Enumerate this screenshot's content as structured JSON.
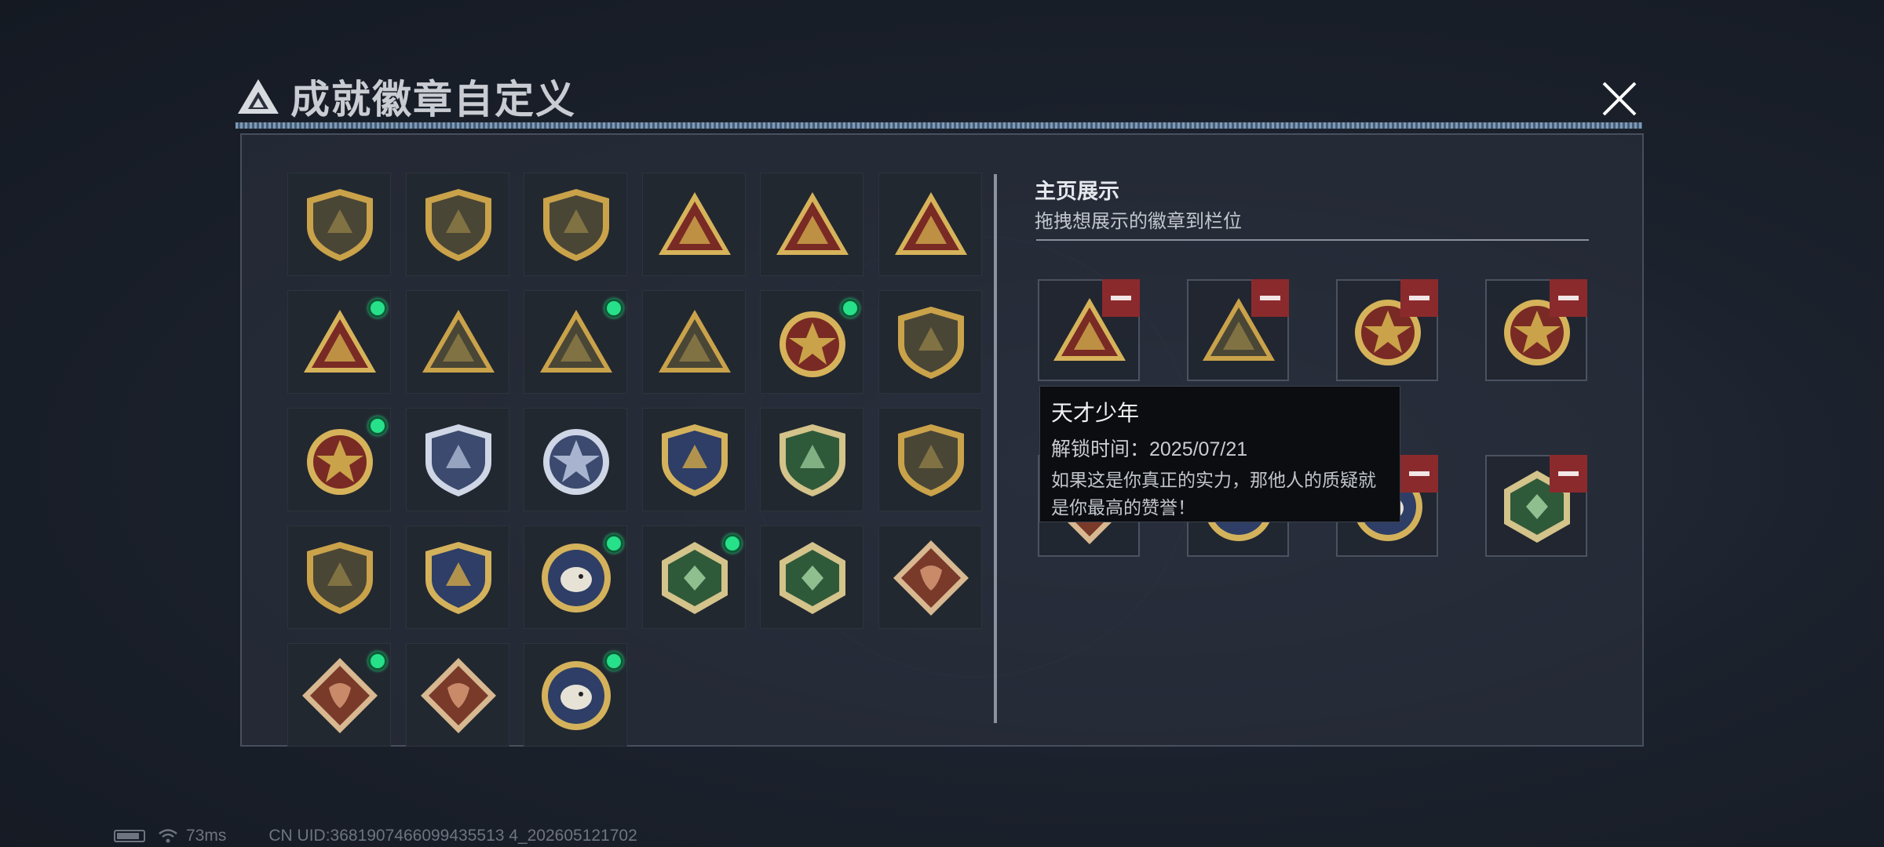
{
  "window": {
    "title": "成就徽章自定义"
  },
  "colors": {
    "accent_new": "#27e08a",
    "remove": "#8b2a2d",
    "gold": "#c9a24a"
  },
  "badge_grid": {
    "rows": [
      [
        {
          "icon": "shield-triangle-badge",
          "shape": "shield",
          "tone": "olive",
          "new": false
        },
        {
          "icon": "helicopter-badge",
          "shape": "shield",
          "tone": "olive",
          "new": false
        },
        {
          "icon": "dagger-shield-badge",
          "shape": "shield",
          "tone": "olive",
          "new": false
        },
        {
          "icon": "ammo-box-triangle-badge",
          "shape": "triangle",
          "tone": "red",
          "new": false
        },
        {
          "icon": "bird-triangle-badge",
          "shape": "triangle",
          "tone": "red",
          "new": false
        },
        {
          "icon": "number-one-triangle-badge",
          "shape": "triangle",
          "tone": "red",
          "new": false
        }
      ],
      [
        {
          "icon": "usb-triangle-badge",
          "shape": "triangle",
          "tone": "red",
          "new": true
        },
        {
          "icon": "runner-triangle-badge",
          "shape": "triangle",
          "tone": "olive",
          "new": false
        },
        {
          "icon": "cube-hands-triangle-badge",
          "shape": "triangle",
          "tone": "olive",
          "new": true
        },
        {
          "icon": "soldiers-triangle-badge",
          "shape": "triangle",
          "tone": "olive",
          "new": false
        },
        {
          "icon": "star-medal-badge",
          "shape": "medal",
          "tone": "red",
          "new": true
        },
        {
          "icon": "emblem-shield-badge",
          "shape": "shield",
          "tone": "olive",
          "new": false
        }
      ],
      [
        {
          "icon": "winged-gold-medal-badge",
          "shape": "medal",
          "tone": "red",
          "new": true
        },
        {
          "icon": "diamond-shield-badge",
          "shape": "shield",
          "tone": "silver",
          "new": false
        },
        {
          "icon": "silver-crest-badge",
          "shape": "medal",
          "tone": "silver",
          "new": false
        },
        {
          "icon": "rifle-gold-shield-badge",
          "shape": "shield",
          "tone": "blue",
          "new": false
        },
        {
          "icon": "rifle-green-shield-badge",
          "shape": "shield",
          "tone": "green",
          "new": false
        },
        {
          "icon": "rifle-olive-shield-badge",
          "shape": "shield",
          "tone": "olive",
          "new": false
        }
      ],
      [
        {
          "icon": "knife-olive-shield-badge",
          "shape": "shield",
          "tone": "olive",
          "new": false
        },
        {
          "icon": "knife-gold-shield-badge",
          "shape": "shield",
          "tone": "blue",
          "new": false
        },
        {
          "icon": "eagle-round-badge",
          "shape": "round",
          "tone": "blue",
          "new": true
        },
        {
          "icon": "hornet-hex-badge",
          "shape": "hex",
          "tone": "green",
          "new": true
        },
        {
          "icon": "hammer-hex-badge",
          "shape": "hex",
          "tone": "green",
          "new": false
        },
        {
          "icon": "dragon-diamond-badge",
          "shape": "diamond",
          "tone": "brown",
          "new": false
        }
      ],
      [
        {
          "icon": "dragon-diamond-badge",
          "shape": "diamond",
          "tone": "brown",
          "new": true
        },
        {
          "icon": "fighter-diamond-badge",
          "shape": "diamond",
          "tone": "brown",
          "new": false
        },
        {
          "icon": "wolf-round-badge",
          "shape": "round",
          "tone": "blue",
          "new": true
        }
      ]
    ]
  },
  "home_display": {
    "title": "主页展示",
    "subtitle": "拖拽想展示的徽章到栏位",
    "slots": [
      {
        "icon": "usb-triangle-badge",
        "shape": "triangle",
        "tone": "red"
      },
      {
        "icon": "cube-hands-triangle-badge",
        "shape": "triangle",
        "tone": "olive"
      },
      {
        "icon": "star-medal-badge",
        "shape": "medal",
        "tone": "red"
      },
      {
        "icon": "winged-gold-medal-badge",
        "shape": "medal",
        "tone": "red"
      },
      {
        "icon": "dragon-diamond-badge",
        "shape": "diamond",
        "tone": "brown"
      },
      {
        "icon": "eagle-round-badge",
        "shape": "round",
        "tone": "blue"
      },
      {
        "icon": "wolf-round-badge",
        "shape": "round",
        "tone": "blue"
      },
      {
        "icon": "hornet-hex-badge",
        "shape": "hex",
        "tone": "green"
      }
    ]
  },
  "tooltip": {
    "title": "天才少年",
    "unlock_time": "解锁时间：2025/07/21",
    "description_line1": "如果这是你真正的实力，那他人的质疑就",
    "description_line2": "是你最高的赞誉！"
  },
  "footer": {
    "ping": "73ms",
    "uid": "CN UID:3681907466099435513 4_202605121702"
  }
}
